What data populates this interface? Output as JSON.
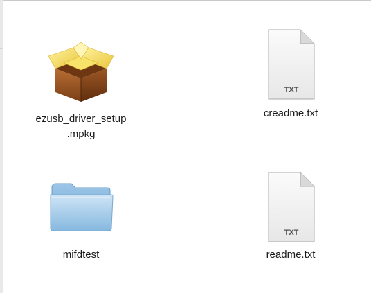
{
  "window": {
    "items": [
      {
        "name": "ezusb_driver_setup\n.mpkg",
        "icon": "package-icon"
      },
      {
        "name": "creadme.txt",
        "icon": "txt-document-icon",
        "badge": "TXT"
      },
      {
        "name": "mifdtest",
        "icon": "folder-icon"
      },
      {
        "name": "readme.txt",
        "icon": "txt-document-icon",
        "badge": "TXT"
      }
    ]
  },
  "colors": {
    "folder_light": "#bcd9ef",
    "folder_dark": "#7fb0d8",
    "box_brown": "#9a5a26",
    "box_yellow": "#f3d84a"
  }
}
